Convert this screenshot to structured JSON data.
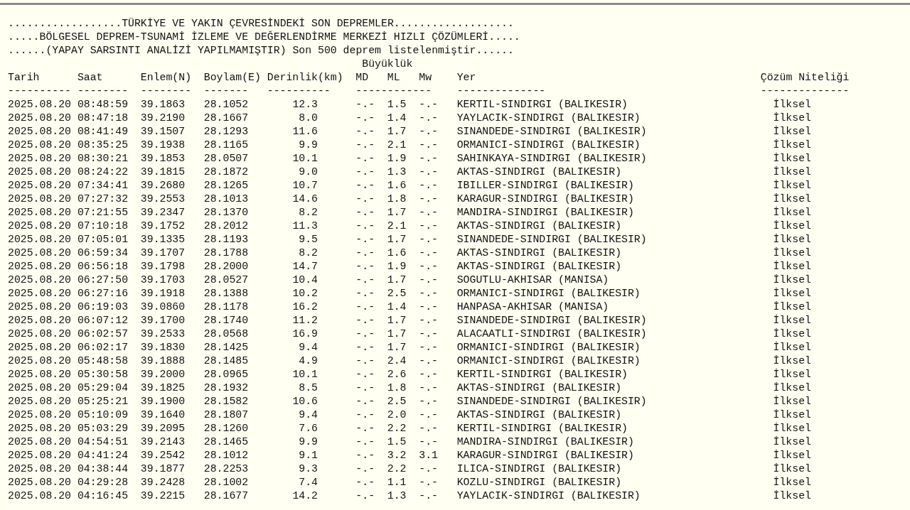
{
  "heading_lines": [
    "..................TÜRKİYE VE YAKIN ÇEVRESİNDEKİ SON DEPREMLER...................",
    ".....BÖLGESEL DEPREM-TSUNAMİ İZLEME VE DEĞERLENDİRME MERKEZİ HIZLI ÇÖZÜMLERİ.....",
    "......(YAPAY SARSINTI ANALİZİ YAPILMAMIŞTIR) Son 500 deprem listelenmiştir......"
  ],
  "table": {
    "group_heading": "Büyüklük",
    "columns": [
      "Tarih",
      "Saat",
      "Enlem(N)",
      "Boylam(E)",
      "Derinlik(km)",
      "MD",
      "ML",
      "Mw",
      "Yer",
      "Çözüm Niteliği"
    ],
    "rules": [
      "----------",
      "--------",
      "--------",
      "-------",
      "----------",
      "------------",
      "--------------",
      "--------------"
    ],
    "rows": [
      {
        "date": "2025.08.20",
        "time": "08:48:59",
        "lat": "39.1863",
        "lon": "28.1052",
        "depth": "12.3",
        "md": "-.-",
        "ml": "1.5",
        "mw": "-.-",
        "place": "KERTIL-SINDIRGI (BALIKESIR)",
        "quality": "İlksel"
      },
      {
        "date": "2025.08.20",
        "time": "08:47:18",
        "lat": "39.2190",
        "lon": "28.1667",
        "depth": "8.0",
        "md": "-.-",
        "ml": "1.4",
        "mw": "-.-",
        "place": "YAYLACIK-SINDIRGI (BALIKESIR)",
        "quality": "İlksel"
      },
      {
        "date": "2025.08.20",
        "time": "08:41:49",
        "lat": "39.1507",
        "lon": "28.1293",
        "depth": "11.6",
        "md": "-.-",
        "ml": "1.7",
        "mw": "-.-",
        "place": "SINANDEDE-SINDIRGI (BALIKESIR)",
        "quality": "İlksel"
      },
      {
        "date": "2025.08.20",
        "time": "08:35:25",
        "lat": "39.1938",
        "lon": "28.1165",
        "depth": "9.9",
        "md": "-.-",
        "ml": "2.1",
        "mw": "-.-",
        "place": "ORMANICI-SINDIRGI (BALIKESIR)",
        "quality": "İlksel"
      },
      {
        "date": "2025.08.20",
        "time": "08:30:21",
        "lat": "39.1853",
        "lon": "28.0507",
        "depth": "10.1",
        "md": "-.-",
        "ml": "1.9",
        "mw": "-.-",
        "place": "SAHINKAYA-SINDIRGI (BALIKESIR)",
        "quality": "İlksel"
      },
      {
        "date": "2025.08.20",
        "time": "08:24:22",
        "lat": "39.1815",
        "lon": "28.1872",
        "depth": "9.0",
        "md": "-.-",
        "ml": "1.3",
        "mw": "-.-",
        "place": "AKTAS-SINDIRGI (BALIKESIR)",
        "quality": "İlksel"
      },
      {
        "date": "2025.08.20",
        "time": "07:34:41",
        "lat": "39.2680",
        "lon": "28.1265",
        "depth": "10.7",
        "md": "-.-",
        "ml": "1.6",
        "mw": "-.-",
        "place": "IBILLER-SINDIRGI (BALIKESIR)",
        "quality": "İlksel"
      },
      {
        "date": "2025.08.20",
        "time": "07:27:32",
        "lat": "39.2553",
        "lon": "28.1013",
        "depth": "14.6",
        "md": "-.-",
        "ml": "1.8",
        "mw": "-.-",
        "place": "KARAGUR-SINDIRGI (BALIKESIR)",
        "quality": "İlksel"
      },
      {
        "date": "2025.08.20",
        "time": "07:21:55",
        "lat": "39.2347",
        "lon": "28.1370",
        "depth": "8.2",
        "md": "-.-",
        "ml": "1.7",
        "mw": "-.-",
        "place": "MANDIRA-SINDIRGI (BALIKESIR)",
        "quality": "İlksel"
      },
      {
        "date": "2025.08.20",
        "time": "07:10:18",
        "lat": "39.1752",
        "lon": "28.2012",
        "depth": "11.3",
        "md": "-.-",
        "ml": "2.1",
        "mw": "-.-",
        "place": "AKTAS-SINDIRGI (BALIKESIR)",
        "quality": "İlksel"
      },
      {
        "date": "2025.08.20",
        "time": "07:05:01",
        "lat": "39.1335",
        "lon": "28.1193",
        "depth": "9.5",
        "md": "-.-",
        "ml": "1.7",
        "mw": "-.-",
        "place": "SINANDEDE-SINDIRGI (BALIKESIR)",
        "quality": "İlksel"
      },
      {
        "date": "2025.08.20",
        "time": "06:59:34",
        "lat": "39.1707",
        "lon": "28.1788",
        "depth": "8.2",
        "md": "-.-",
        "ml": "1.6",
        "mw": "-.-",
        "place": "AKTAS-SINDIRGI (BALIKESIR)",
        "quality": "İlksel"
      },
      {
        "date": "2025.08.20",
        "time": "06:56:18",
        "lat": "39.1798",
        "lon": "28.2000",
        "depth": "14.7",
        "md": "-.-",
        "ml": "1.9",
        "mw": "-.-",
        "place": "AKTAS-SINDIRGI (BALIKESIR)",
        "quality": "İlksel"
      },
      {
        "date": "2025.08.20",
        "time": "06:27:50",
        "lat": "39.1703",
        "lon": "28.0527",
        "depth": "10.4",
        "md": "-.-",
        "ml": "1.7",
        "mw": "-.-",
        "place": "SOGUTLU-AKHISAR (MANISA)",
        "quality": "İlksel"
      },
      {
        "date": "2025.08.20",
        "time": "06:27:16",
        "lat": "39.1918",
        "lon": "28.1388",
        "depth": "10.2",
        "md": "-.-",
        "ml": "2.5",
        "mw": "-.-",
        "place": "ORMANICI-SINDIRGI (BALIKESIR)",
        "quality": "İlksel"
      },
      {
        "date": "2025.08.20",
        "time": "06:19:03",
        "lat": "39.0860",
        "lon": "28.1178",
        "depth": "16.2",
        "md": "-.-",
        "ml": "1.4",
        "mw": "-.-",
        "place": "HANPASA-AKHISAR (MANISA)",
        "quality": "İlksel"
      },
      {
        "date": "2025.08.20",
        "time": "06:07:12",
        "lat": "39.1700",
        "lon": "28.1740",
        "depth": "11.2",
        "md": "-.-",
        "ml": "1.7",
        "mw": "-.-",
        "place": "SINANDEDE-SINDIRGI (BALIKESIR)",
        "quality": "İlksel"
      },
      {
        "date": "2025.08.20",
        "time": "06:02:57",
        "lat": "39.2533",
        "lon": "28.0568",
        "depth": "16.9",
        "md": "-.-",
        "ml": "1.7",
        "mw": "-.-",
        "place": "ALACAATLI-SINDIRGI (BALIKESIR)",
        "quality": "İlksel"
      },
      {
        "date": "2025.08.20",
        "time": "06:02:17",
        "lat": "39.1830",
        "lon": "28.1425",
        "depth": "9.4",
        "md": "-.-",
        "ml": "1.7",
        "mw": "-.-",
        "place": "ORMANICI-SINDIRGI (BALIKESIR)",
        "quality": "İlksel"
      },
      {
        "date": "2025.08.20",
        "time": "05:48:58",
        "lat": "39.1888",
        "lon": "28.1485",
        "depth": "4.9",
        "md": "-.-",
        "ml": "2.4",
        "mw": "-.-",
        "place": "ORMANICI-SINDIRGI (BALIKESIR)",
        "quality": "İlksel"
      },
      {
        "date": "2025.08.20",
        "time": "05:30:58",
        "lat": "39.2000",
        "lon": "28.0965",
        "depth": "10.1",
        "md": "-.-",
        "ml": "2.6",
        "mw": "-.-",
        "place": "KERTIL-SINDIRGI (BALIKESIR)",
        "quality": "İlksel"
      },
      {
        "date": "2025.08.20",
        "time": "05:29:04",
        "lat": "39.1825",
        "lon": "28.1932",
        "depth": "8.5",
        "md": "-.-",
        "ml": "1.8",
        "mw": "-.-",
        "place": "AKTAS-SINDIRGI (BALIKESIR)",
        "quality": "İlksel"
      },
      {
        "date": "2025.08.20",
        "time": "05:25:21",
        "lat": "39.1900",
        "lon": "28.1582",
        "depth": "10.6",
        "md": "-.-",
        "ml": "2.5",
        "mw": "-.-",
        "place": "SINANDEDE-SINDIRGI (BALIKESIR)",
        "quality": "İlksel"
      },
      {
        "date": "2025.08.20",
        "time": "05:10:09",
        "lat": "39.1640",
        "lon": "28.1807",
        "depth": "9.4",
        "md": "-.-",
        "ml": "2.0",
        "mw": "-.-",
        "place": "AKTAS-SINDIRGI (BALIKESIR)",
        "quality": "İlksel"
      },
      {
        "date": "2025.08.20",
        "time": "05:03:29",
        "lat": "39.2095",
        "lon": "28.1260",
        "depth": "7.6",
        "md": "-.-",
        "ml": "2.2",
        "mw": "-.-",
        "place": "KERTIL-SINDIRGI (BALIKESIR)",
        "quality": "İlksel"
      },
      {
        "date": "2025.08.20",
        "time": "04:54:51",
        "lat": "39.2143",
        "lon": "28.1465",
        "depth": "9.9",
        "md": "-.-",
        "ml": "1.5",
        "mw": "-.-",
        "place": "MANDIRA-SINDIRGI (BALIKESIR)",
        "quality": "İlksel"
      },
      {
        "date": "2025.08.20",
        "time": "04:41:24",
        "lat": "39.2542",
        "lon": "28.1012",
        "depth": "9.1",
        "md": "-.-",
        "ml": "3.2",
        "mw": "3.1",
        "place": "KARAGUR-SINDIRGI (BALIKESIR)",
        "quality": "İlksel"
      },
      {
        "date": "2025.08.20",
        "time": "04:38:44",
        "lat": "39.1877",
        "lon": "28.2253",
        "depth": "9.3",
        "md": "-.-",
        "ml": "2.2",
        "mw": "-.-",
        "place": "ILICA-SINDIRGI (BALIKESIR)",
        "quality": "İlksel"
      },
      {
        "date": "2025.08.20",
        "time": "04:29:28",
        "lat": "39.2428",
        "lon": "28.1002",
        "depth": "7.4",
        "md": "-.-",
        "ml": "1.1",
        "mw": "-.-",
        "place": "KOZLU-SINDIRGI (BALIKESIR)",
        "quality": "İlksel"
      },
      {
        "date": "2025.08.20",
        "time": "04:16:45",
        "lat": "39.2215",
        "lon": "28.1677",
        "depth": "14.2",
        "md": "-.-",
        "ml": "1.3",
        "mw": "-.-",
        "place": "YAYLACIK-SINDIRGI (BALIKESIR)",
        "quality": "İlksel"
      }
    ]
  }
}
